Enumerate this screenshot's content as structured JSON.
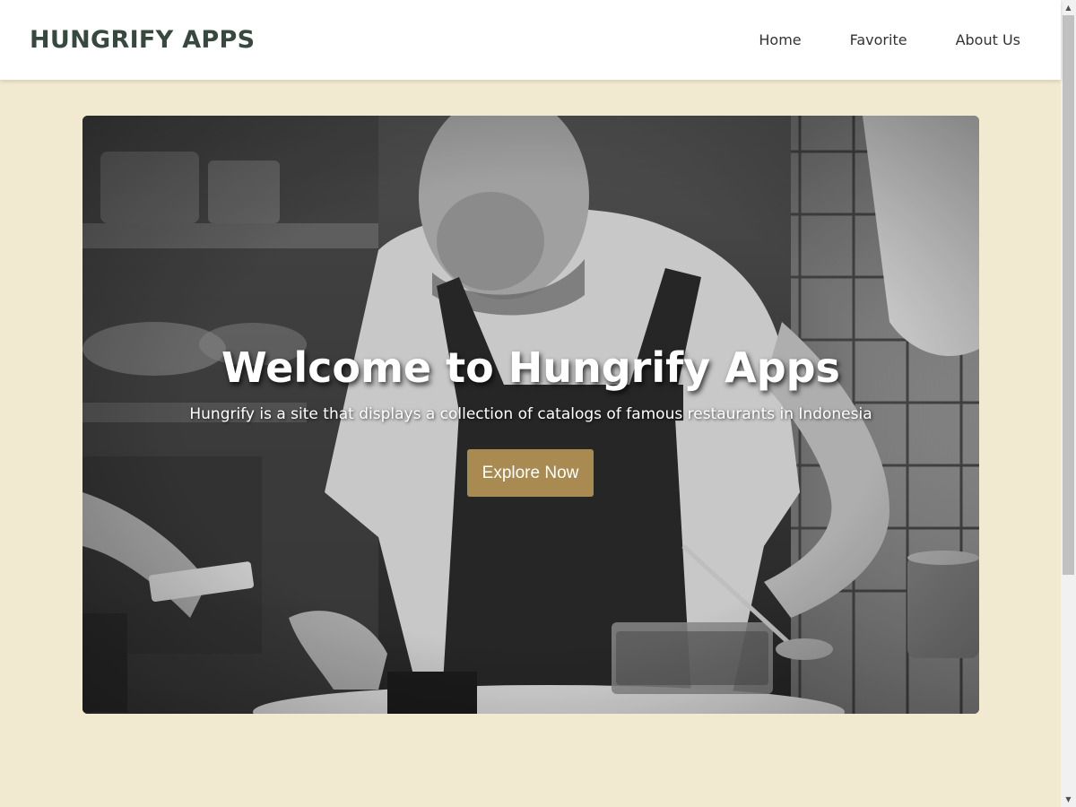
{
  "header": {
    "brand": "HUNGRIFY APPS",
    "nav": [
      {
        "label": "Home"
      },
      {
        "label": "Favorite"
      },
      {
        "label": "About Us"
      }
    ]
  },
  "hero": {
    "title": "Welcome to Hungrify Apps",
    "subtitle": "Hungrify is a site that displays a collection of catalogs of famous restaurants in Indonesia",
    "cta_label": "Explore Now"
  },
  "colors": {
    "page_background": "#f1ead0",
    "brand_text": "#37493f",
    "cta_background": "#a98b52"
  },
  "icons": {
    "scroll_up": "scroll-up-arrow-icon",
    "scroll_down": "scroll-down-arrow-icon"
  }
}
